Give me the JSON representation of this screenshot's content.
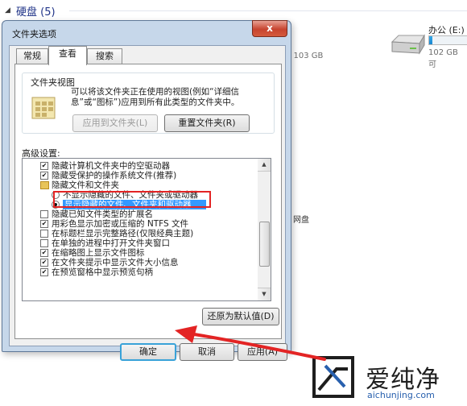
{
  "explorer": {
    "section_title": "硬盘 (5)",
    "drive_left_capacity": ", 共 103 GB",
    "drive_e_label": "办公 (E:)",
    "drive_e_capacity": "102 GB 可",
    "drive_e_used_fraction": 0.06,
    "netdisk_label": "网盘"
  },
  "dialog": {
    "title": "文件夹选项",
    "close_glyph": "x",
    "tabs": [
      {
        "label": "常规"
      },
      {
        "label": "查看"
      },
      {
        "label": "搜索"
      }
    ],
    "folder_views": {
      "legend": "文件夹视图",
      "description": "可以将该文件夹正在使用的视图(例如“详细信息”或“图标”)应用到所有此类型的文件夹中。",
      "apply_button": "应用到文件夹(L)",
      "reset_button": "重置文件夹(R)"
    },
    "advanced_label": "高级设置:",
    "settings": [
      {
        "label": "隐藏计算机文件夹中的空驱动器",
        "kind": "checkbox",
        "checked": true,
        "indent": 0
      },
      {
        "label": "隐藏受保护的操作系统文件(推荐)",
        "kind": "checkbox",
        "checked": true,
        "indent": 0
      },
      {
        "label": "隐藏文件和文件夹",
        "kind": "folder",
        "indent": 0
      },
      {
        "label": "不显示隐藏的文件、文件夹或驱动器",
        "kind": "radio",
        "checked": false,
        "indent": 1
      },
      {
        "label": "显示隐藏的文件、文件夹和驱动器",
        "kind": "radio",
        "checked": true,
        "indent": 1,
        "selected": true
      },
      {
        "label": "隐藏已知文件类型的扩展名",
        "kind": "checkbox",
        "checked": false,
        "indent": 0
      },
      {
        "label": "用彩色显示加密或压缩的 NTFS 文件",
        "kind": "checkbox",
        "checked": true,
        "indent": 0
      },
      {
        "label": "在标题栏显示完整路径(仅限经典主题)",
        "kind": "checkbox",
        "checked": false,
        "indent": 0
      },
      {
        "label": "在单独的进程中打开文件夹窗口",
        "kind": "checkbox",
        "checked": false,
        "indent": 0
      },
      {
        "label": "在缩略图上显示文件图标",
        "kind": "checkbox",
        "checked": true,
        "indent": 0
      },
      {
        "label": "在文件夹提示中显示文件大小信息",
        "kind": "checkbox",
        "checked": true,
        "indent": 0
      },
      {
        "label": "在预览窗格中显示预览句柄",
        "kind": "checkbox",
        "checked": true,
        "indent": 0
      }
    ],
    "restore_button": "还原为默认值(D)",
    "ok_button": "确定",
    "cancel_button": "取消",
    "apply_button": "应用(A)"
  },
  "watermark": {
    "brand": "爱纯净",
    "url": "aichunjing.com"
  },
  "colors": {
    "annotation_red": "#e32424",
    "selection_blue": "#3399ff",
    "watermark_blue": "#2860ae"
  }
}
